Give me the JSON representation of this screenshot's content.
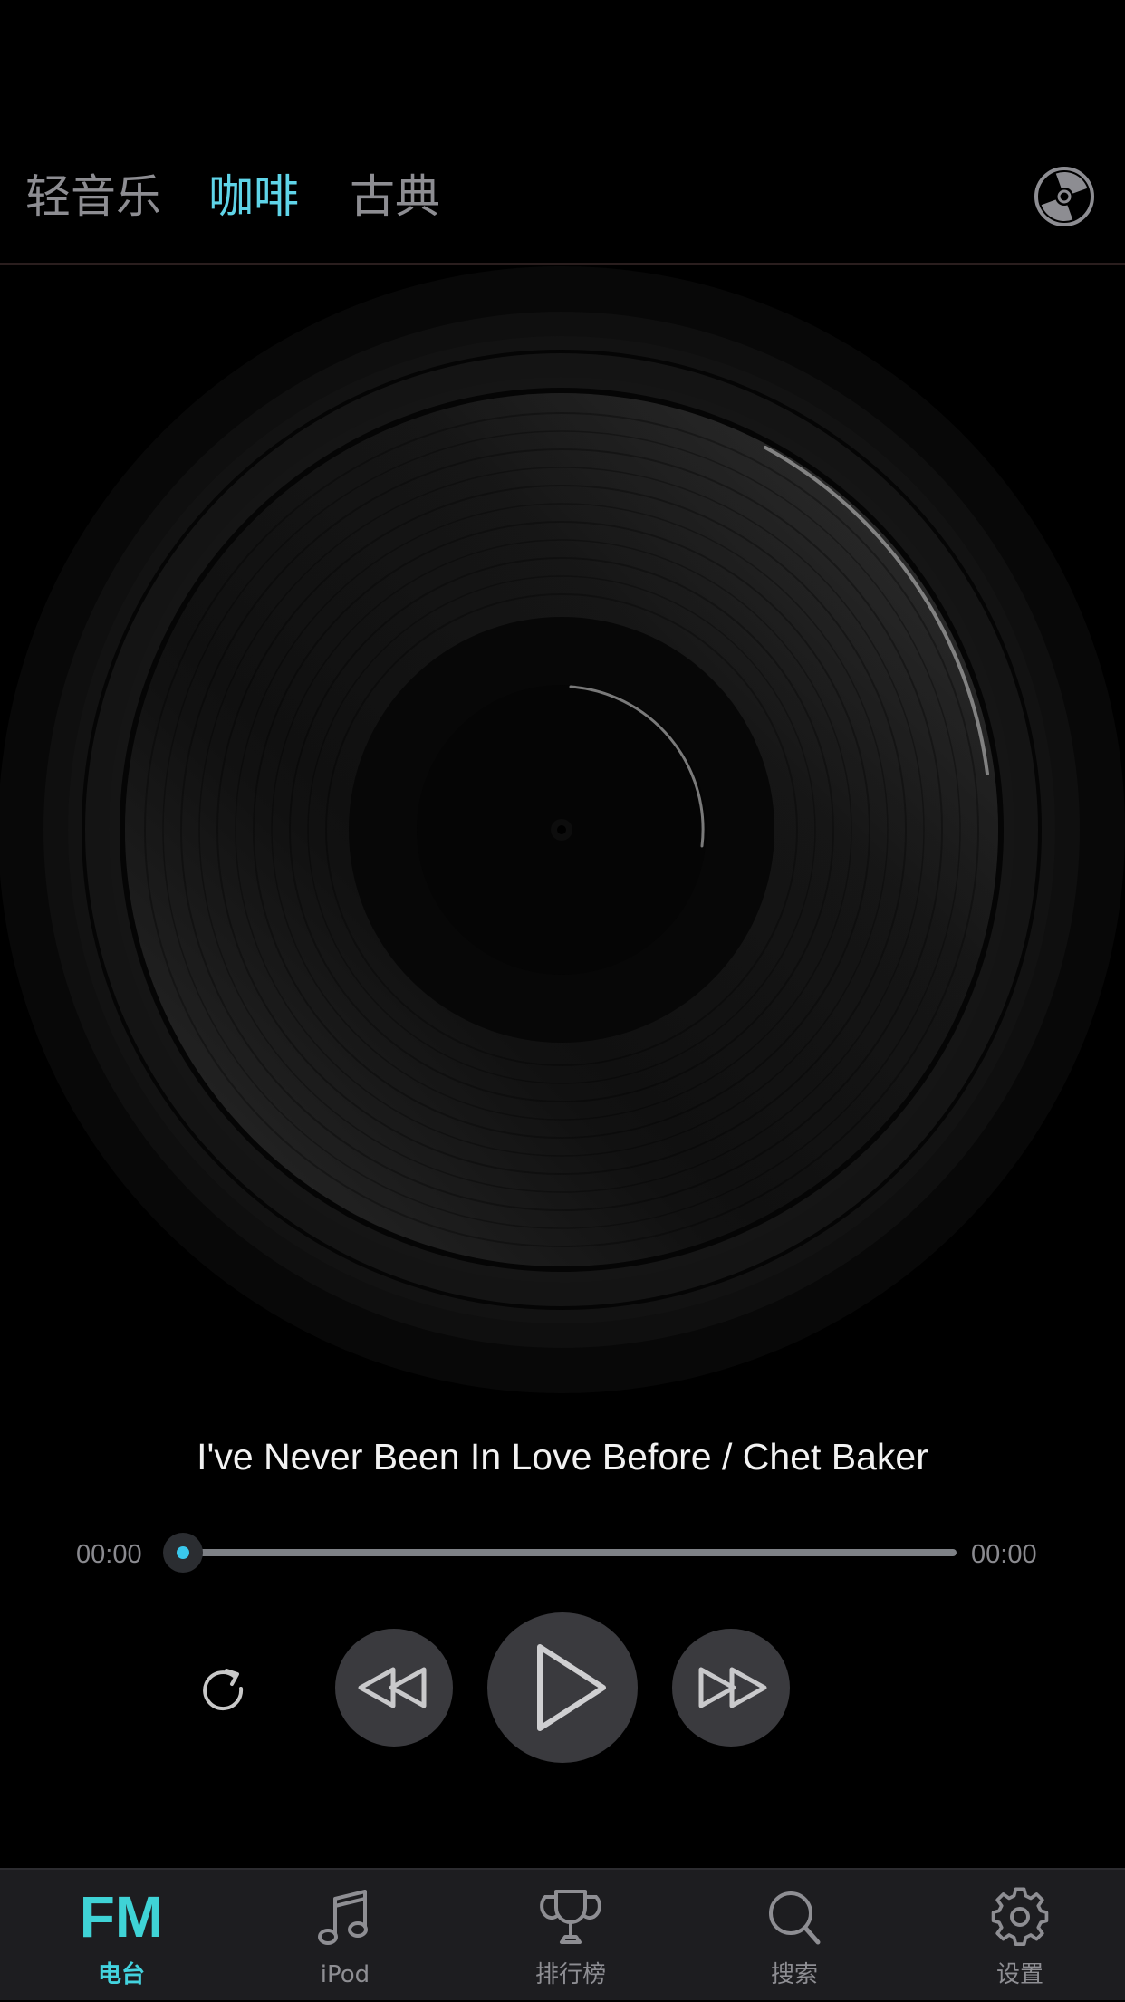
{
  "colors": {
    "accent": "#5fd4e8",
    "tab_inactive": "#8d8d92",
    "progress_fill": "#36c6e6",
    "tabbar_active": "#43d3df",
    "background": "#000000"
  },
  "genre_tabs": [
    {
      "label": "轻音乐",
      "active": false
    },
    {
      "label": "咖啡",
      "active": true
    },
    {
      "label": "古典",
      "active": false
    }
  ],
  "header": {
    "disc_icon": "vinyl-disc-icon"
  },
  "player": {
    "track_title": "I've Never Been In Love Before / Chet Baker",
    "elapsed": "00:00",
    "total": "00:00",
    "progress": 0
  },
  "controls": {
    "repeat_icon": "repeat-icon",
    "rewind_icon": "rewind-icon",
    "play_icon": "play-icon",
    "forward_icon": "fast-forward-icon"
  },
  "tab_bar": [
    {
      "icon_text": "FM",
      "label": "电台",
      "active": true,
      "icon": "fm-icon"
    },
    {
      "label": "iPod",
      "active": false,
      "icon": "music-note-icon"
    },
    {
      "label": "排行榜",
      "active": false,
      "icon": "trophy-icon"
    },
    {
      "label": "搜索",
      "active": false,
      "icon": "search-icon"
    },
    {
      "label": "设置",
      "active": false,
      "icon": "gear-icon"
    }
  ]
}
